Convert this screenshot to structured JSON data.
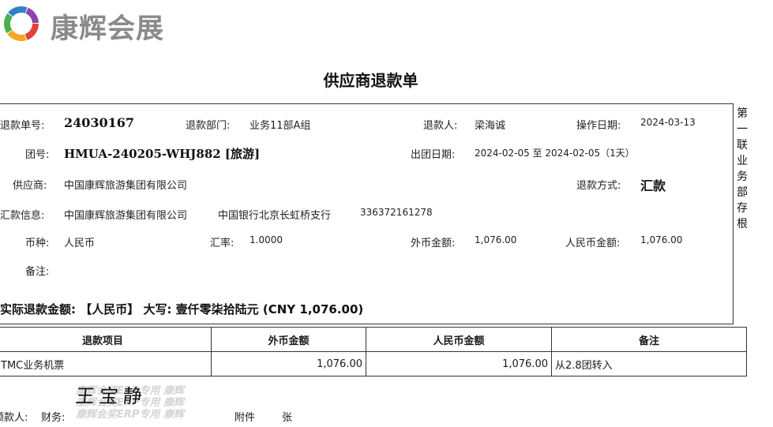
{
  "brand": {
    "name": "康辉会展",
    "colors": [
      "#e2403b",
      "#f5a623",
      "#4caf50",
      "#2f80c8",
      "#8e44ad"
    ]
  },
  "title": "供应商退款单",
  "stub_text": "第一联业务部存根",
  "form": {
    "refund_no_label": "退款单号:",
    "refund_no": "24030167",
    "department_label": "退款部门:",
    "department": "业务11部A组",
    "refunder_label": "退款人:",
    "refunder": "梁海诚",
    "op_date_label": "操作日期:",
    "op_date": "2024-03-13",
    "group_no_label": "团号:",
    "group_no": "HMUA-240205-WHJ882 [旅游]",
    "depart_date_label": "出团日期:",
    "depart_date": "2024-02-05 至 2024-02-05（1天）",
    "supplier_label": "供应商:",
    "supplier": "中国康辉旅游集团有限公司",
    "method_label": "退款方式:",
    "method": "汇款",
    "remit_label": "汇款信息:",
    "remit_company": "中国康辉旅游集团有限公司",
    "remit_bank": "中国银行北京长虹桥支行",
    "remit_account": "336372161278",
    "currency_label": "币种:",
    "currency": "人民币",
    "rate_label": "汇率:",
    "rate": "1.0000",
    "foreign_amount_label": "外币金额:",
    "foreign_amount": "1,076.00",
    "rmb_amount_label": "人民币金额:",
    "rmb_amount": "1,076.00",
    "remark_label": "备注:",
    "remark": ""
  },
  "total_line": "实际退款金额: 【人民币】 大写: 壹仟零柒拾陆元  (CNY 1,076.00)",
  "table": {
    "headers": [
      "退款项目",
      "外币金额",
      "人民币金额",
      "备注"
    ],
    "rows": [
      [
        "TMC业务机票",
        "1,076.00",
        "1,076.00",
        "从2.8团转入"
      ]
    ]
  },
  "signature": "王宝静",
  "watermark": [
    "康辉会奖ERP专用 康辉",
    "康辉会奖ERP专用 康辉",
    "康辉会奖ERP专用 康辉"
  ],
  "footer": {
    "recipient_label": "领款人:",
    "finance_label": "财务:",
    "attachment_label": "附件",
    "sheets_label": "张"
  }
}
